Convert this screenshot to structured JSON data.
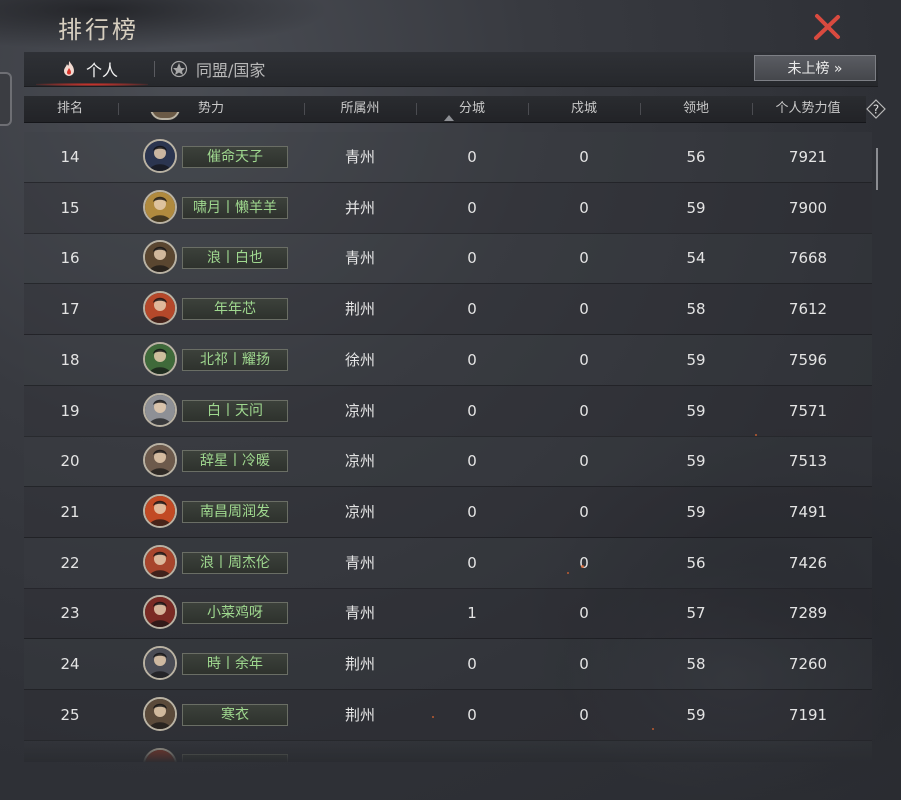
{
  "title": "排行榜",
  "tabs": {
    "personal": "个人",
    "alliance": "同盟/国家"
  },
  "unlisted_button": "未上榜 »",
  "columns": [
    "排名",
    "势力",
    "所属州",
    "分城",
    "戍城",
    "领地",
    "个人势力值"
  ],
  "rows": [
    {
      "rank": "14",
      "name": "催命天子",
      "province": "青州",
      "branch_cities": "0",
      "garrison_cities": "0",
      "territory": "56",
      "power": "7921",
      "avatar_color": "#2b3550"
    },
    {
      "rank": "15",
      "name": "啸月丨懒羊羊",
      "province": "并州",
      "branch_cities": "0",
      "garrison_cities": "0",
      "territory": "59",
      "power": "7900",
      "avatar_color": "#b08a3e"
    },
    {
      "rank": "16",
      "name": "浪丨白也",
      "province": "青州",
      "branch_cities": "0",
      "garrison_cities": "0",
      "territory": "54",
      "power": "7668",
      "avatar_color": "#5a4630"
    },
    {
      "rank": "17",
      "name": "年年芯",
      "province": "荆州",
      "branch_cities": "0",
      "garrison_cities": "0",
      "territory": "58",
      "power": "7612",
      "avatar_color": "#b5482a"
    },
    {
      "rank": "18",
      "name": "北祁丨耀扬",
      "province": "徐州",
      "branch_cities": "0",
      "garrison_cities": "0",
      "territory": "59",
      "power": "7596",
      "avatar_color": "#3f6a3a"
    },
    {
      "rank": "19",
      "name": "白丨天问",
      "province": "凉州",
      "branch_cities": "0",
      "garrison_cities": "0",
      "territory": "59",
      "power": "7571",
      "avatar_color": "#8e9096"
    },
    {
      "rank": "20",
      "name": "辞星丨冷暖",
      "province": "凉州",
      "branch_cities": "0",
      "garrison_cities": "0",
      "territory": "59",
      "power": "7513",
      "avatar_color": "#6d5a4c"
    },
    {
      "rank": "21",
      "name": "南昌周润发",
      "province": "凉州",
      "branch_cities": "0",
      "garrison_cities": "0",
      "territory": "59",
      "power": "7491",
      "avatar_color": "#c24a24"
    },
    {
      "rank": "22",
      "name": "浪丨周杰伦",
      "province": "青州",
      "branch_cities": "0",
      "garrison_cities": "0",
      "territory": "56",
      "power": "7426",
      "avatar_color": "#a8452c"
    },
    {
      "rank": "23",
      "name": "小菜鸡呀",
      "province": "青州",
      "branch_cities": "1",
      "garrison_cities": "0",
      "territory": "57",
      "power": "7289",
      "avatar_color": "#7a2a24"
    },
    {
      "rank": "24",
      "name": "時丨余年",
      "province": "荆州",
      "branch_cities": "0",
      "garrison_cities": "0",
      "territory": "58",
      "power": "7260",
      "avatar_color": "#4a4c55"
    },
    {
      "rank": "25",
      "name": "寒衣",
      "province": "荆州",
      "branch_cities": "0",
      "garrison_cities": "0",
      "territory": "59",
      "power": "7191",
      "avatar_color": "#5b4a3a"
    }
  ],
  "colors": {
    "name_green": "#9fd88f",
    "close_red": "#d94a3f",
    "tab_highlight": "#d9342b"
  }
}
